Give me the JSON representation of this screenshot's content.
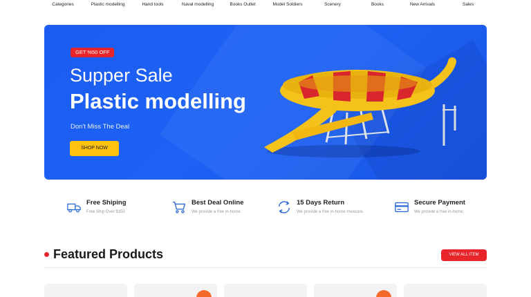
{
  "nav": {
    "items": [
      "Categories",
      "Plastic modelling",
      "Hand tools",
      "Naval modelling",
      "Books Outlet",
      "Model Soldiers",
      "Scenery",
      "Books",
      "New Arrivals",
      "Sales"
    ]
  },
  "hero": {
    "badge": "GET %50 OFF",
    "subtitle": "Supper Sale",
    "title": "Plastic modelling",
    "tagline": "Don't Miss The Deal",
    "button": "SHOP NOW",
    "image_icon": "water-slide-image"
  },
  "features": [
    {
      "title": "Free Shiping",
      "desc": "Free Ship Over  $150",
      "icon": "truck-icon"
    },
    {
      "title": "Best Deal Online",
      "desc": "We provide a free in-home.",
      "icon": "cart-icon"
    },
    {
      "title": "15 Days Return",
      "desc": "We provide a free in-home measure.",
      "icon": "return-icon"
    },
    {
      "title": "Secure Payment",
      "desc": "We provide a free in-home.",
      "icon": "credit-card-icon"
    }
  ],
  "featured": {
    "title": "Featured Products",
    "view_all": "VIEW ALL ITEM"
  },
  "colors": {
    "hero_blue": "#1d62f5",
    "accent_red": "#e7252b",
    "button_yellow": "#ffc20e",
    "icon_blue": "#2a6bd8",
    "sale_orange": "#f46a2c"
  }
}
